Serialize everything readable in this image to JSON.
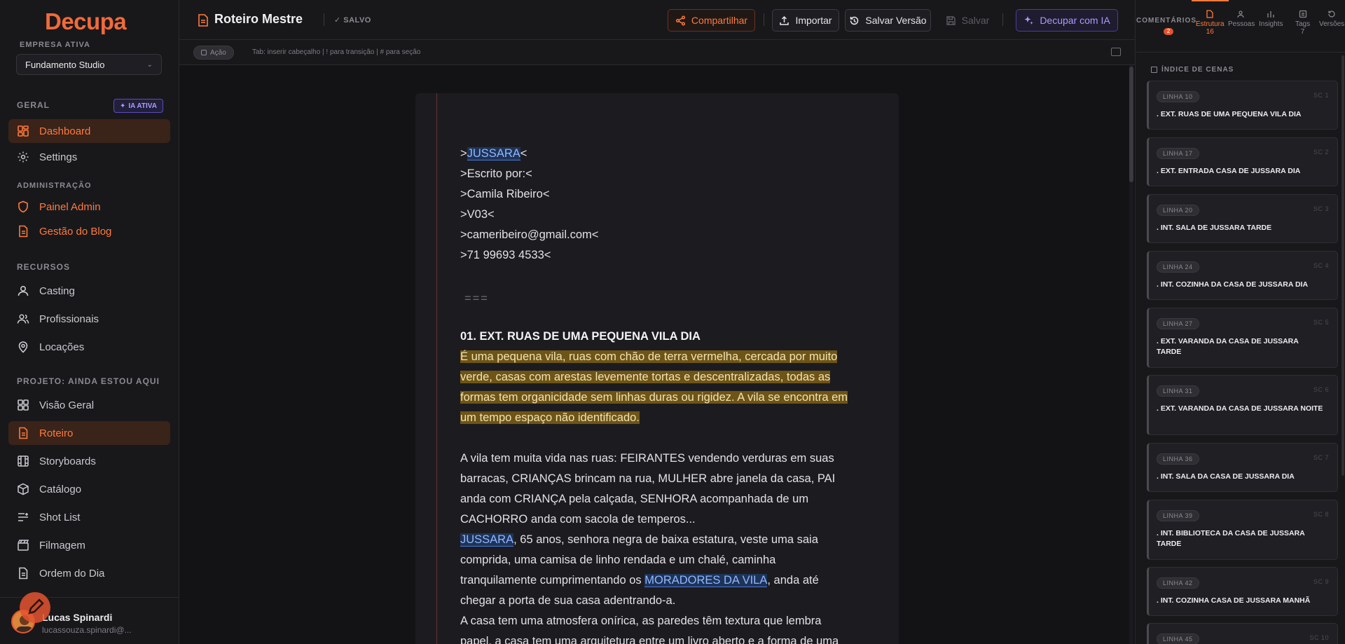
{
  "app": {
    "logo": "Decupa",
    "company_label": "EMPRESA ATIVA",
    "company": "Fundamento Studio"
  },
  "sidebar": {
    "sections": {
      "geral": "GERAL",
      "ia_badge": "IA ATIVA",
      "admin": "ADMINISTRAÇÃO",
      "recursos": "RECURSOS",
      "projeto": "PROJETO: AINDA ESTOU AQUI"
    },
    "items": {
      "dashboard": "Dashboard",
      "settings": "Settings",
      "painel_admin": "Painel Admin",
      "gestao_blog": "Gestão do Blog",
      "casting": "Casting",
      "profissionais": "Profissionais",
      "locacoes": "Locações",
      "visao_geral": "Visão Geral",
      "roteiro": "Roteiro",
      "storyboards": "Storyboards",
      "catalogo": "Catálogo",
      "shot_list": "Shot List",
      "filmagem": "Filmagem",
      "ordem_do_dia": "Ordem do Dia"
    },
    "user": {
      "name": "Lucas Spinardi",
      "email": "lucassouza.spinardi@..."
    }
  },
  "topbar": {
    "title": "Roteiro Mestre",
    "saved": "✓ SALVO",
    "share": "Compartilhar",
    "import": "Importar",
    "save_version": "Salvar Versão",
    "save": "Salvar",
    "ai": "Decupar com IA"
  },
  "toolbar": {
    "mode": "Ação",
    "hint": "Tab: inserir cabeçalho | ! para transição | # para seção"
  },
  "script": {
    "title_pre": ">",
    "title_name": "JUSSARA",
    "title_post": "<",
    "written_by": ">Escrito por:<",
    "author": ">Camila Ribeiro<",
    "version": ">V03<",
    "email": ">cameribeiro@gmail.com<",
    "phone": ">71 99693 4533<",
    "separator": "===",
    "scene1": "01. EXT. RUAS DE UMA PEQUENA VILA DIA",
    "action1": " É uma pequena vila, ruas com chão de terra vermelha, cercada por muito verde, casas com arestas levemente tortas e descentralizadas, todas as formas tem organicidade sem linhas duras ou rigidez. A vila se encontra em um tempo espaço não identificado.",
    "action2": "A vila tem muita vida nas ruas: FEIRANTES vendendo verduras em suas barracas, CRIANÇAS brincam na rua, MULHER abre janela da casa, PAI anda com CRIANÇA pela calçada, SENHORA acompanhada de um CACHORRO anda com sacola de temperos...",
    "char1": "JUSSARA",
    "action3a": ", 65 anos, senhora negra de baixa estatura, veste uma saia comprida, uma camisa de linho rendada e um chalé, caminha tranquilamente cumprimentando os ",
    "char2": "MORADORES DA VILA",
    "action3b": ", anda até chegar a porta de sua casa adentrando-a.",
    "action4": "A casa tem uma atmosfera onírica, as paredes têm textura que lembra papel, a casa tem uma arquitetura entre um livro aberto e a forma de uma casa."
  },
  "rpanel": {
    "comments": "COMENTÁRIOS",
    "comments_count": "2",
    "tab_estrutura": "Estrutura",
    "tab_estrutura_count": "16",
    "tab_pessoas": "Pessoas",
    "tab_insights": "Insights",
    "tab_tags": "Tags",
    "tab_tags_count": "7",
    "tab_versoes": "Versões",
    "index_title": "ÍNDICE DE CENAS",
    "scenes": [
      {
        "line": "LINHA 10",
        "sc": "SC 1",
        "title": ". EXT. RUAS DE UMA PEQUENA VILA DIA"
      },
      {
        "line": "LINHA 17",
        "sc": "SC 2",
        "title": ". EXT. ENTRADA CASA DE JUSSARA DIA"
      },
      {
        "line": "LINHA 20",
        "sc": "SC 3",
        "title": ". INT. SALA DE JUSSARA TARDE"
      },
      {
        "line": "LINHA 24",
        "sc": "SC 4",
        "title": ". INT. COZINHA DA CASA DE JUSSARA DIA"
      },
      {
        "line": "LINHA 27",
        "sc": "SC 5",
        "title": ". EXT. VARANDA DA CASA DE JUSSARA TARDE"
      },
      {
        "line": "LINHA 31",
        "sc": "SC 6",
        "title": ". EXT. VARANDA DA CASA DE JUSSARA NOITE"
      },
      {
        "line": "LINHA 36",
        "sc": "SC 7",
        "title": ". INT. SALA DA CASA DE JUSSARA DIA"
      },
      {
        "line": "LINHA 39",
        "sc": "SC 8",
        "title": ". INT. BIBLIOTECA DA CASA DE JUSSARA TARDE"
      },
      {
        "line": "LINHA 42",
        "sc": "SC 9",
        "title": ". INT. COZINHA CASA DE JUSSARA MANHÃ"
      },
      {
        "line": "LINHA 45",
        "sc": "SC 10",
        "title": ""
      }
    ]
  },
  "colors": {
    "accent": "#ff7a3c",
    "ai": "#a89cff",
    "highlight_yellow": "#6e5416",
    "highlight_blue": "#1e3358"
  }
}
